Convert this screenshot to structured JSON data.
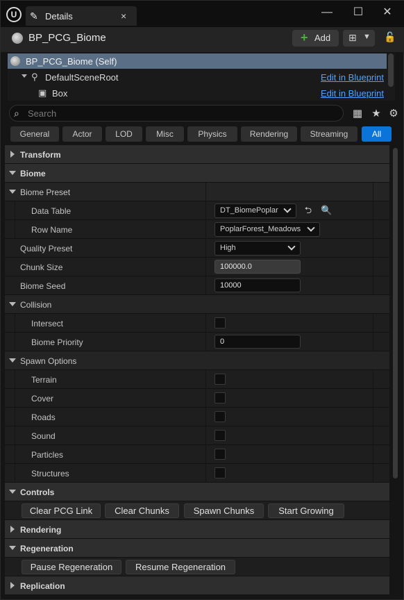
{
  "window": {
    "logo": "U",
    "tab_title": "Details",
    "tab_close": "×",
    "min": "—",
    "max": "☐",
    "close": "✕"
  },
  "header": {
    "title": "BP_PCG_Biome",
    "add_label": "Add",
    "add_plus": "+"
  },
  "tree": {
    "rows": [
      {
        "label": "BP_PCG_Biome (Self)",
        "edit": ""
      },
      {
        "label": "DefaultSceneRoot",
        "edit": "Edit in Blueprint"
      },
      {
        "label": "Box",
        "edit": "Edit in Blueprint"
      }
    ]
  },
  "search": {
    "placeholder": "Search"
  },
  "filters": [
    "General",
    "Actor",
    "LOD",
    "Misc",
    "Physics",
    "Rendering",
    "Streaming",
    "All"
  ],
  "active_filter": "All",
  "categories": {
    "transform": "Transform",
    "biome": "Biome",
    "biome_preset": "Biome Preset",
    "collision": "Collision",
    "spawn_options": "Spawn Options",
    "controls": "Controls",
    "rendering": "Rendering",
    "regeneration": "Regeneration",
    "replication": "Replication"
  },
  "props": {
    "data_table": {
      "label": "Data Table",
      "value": "DT_BiomePoplar"
    },
    "row_name": {
      "label": "Row Name",
      "value": "PoplarForest_Meadows"
    },
    "quality_preset": {
      "label": "Quality Preset",
      "value": "High"
    },
    "chunk_size": {
      "label": "Chunk Size",
      "value": "100000.0"
    },
    "biome_seed": {
      "label": "Biome Seed",
      "value": "10000"
    },
    "intersect": {
      "label": "Intersect"
    },
    "biome_priority": {
      "label": "Biome Priority",
      "value": "0"
    },
    "terrain": {
      "label": "Terrain"
    },
    "cover": {
      "label": "Cover"
    },
    "roads": {
      "label": "Roads"
    },
    "sound": {
      "label": "Sound"
    },
    "particles": {
      "label": "Particles"
    },
    "structures": {
      "label": "Structures"
    }
  },
  "controls": {
    "clear_pcg_link": "Clear PCG Link",
    "clear_chunks": "Clear Chunks",
    "spawn_chunks": "Spawn Chunks",
    "start_growing": "Start Growing"
  },
  "regeneration": {
    "pause": "Pause Regeneration",
    "resume": "Resume Regeneration"
  },
  "colors": {
    "accent": "#0a74d8",
    "link": "#4da3ff",
    "selection": "#5a6e85",
    "add_plus": "#4caf3a"
  }
}
